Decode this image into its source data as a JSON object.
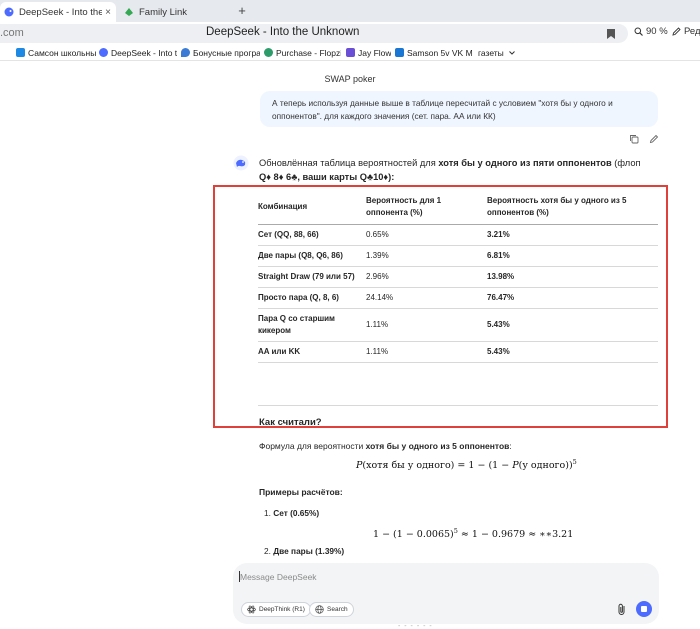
{
  "browser": {
    "tabs": [
      {
        "title": "DeepSeek - Into the Unknown",
        "active": true
      },
      {
        "title": "Family Link",
        "active": false
      }
    ],
    "new_tab_symbol": "+",
    "close_symbol": "×",
    "omnibox": {
      "domain": ".com",
      "title": "DeepSeek - Into the Unknown"
    },
    "zoom": "90 %",
    "edit_label": "Реда",
    "bookmarks": [
      {
        "label": "Самсон школьны",
        "color": "#1e88e5"
      },
      {
        "label": "DeepSeek - Into th",
        "color": "#4d6bfe"
      },
      {
        "label": "Бонусные програ",
        "color": "#3a7bd5"
      },
      {
        "label": "Purchase - Flopzil",
        "color": "#2e9c6a"
      },
      {
        "label": "Jay Flow",
        "color": "#6a4fd6"
      },
      {
        "label": "Samson 5v VK Me",
        "color": "#1976d2"
      },
      {
        "label": "газеты",
        "color": ""
      }
    ]
  },
  "chat": {
    "title": "SWAP poker",
    "user_message": {
      "line1": "А теперь используя данные выше в таблице пересчитай с условием \"хотя бы у одного и",
      "line2": "оппонентов\". для каждого значения (сет. пара. АА или КК)"
    },
    "answer_intro": {
      "prefix": "Обновлённая таблица вероятностей для ",
      "bold": "хотя бы у одного из пяти оппонентов",
      "suffix": " (флоп",
      "line2": "Q♦ 8♦ 6♣, ваши карты Q♣10♦):"
    },
    "table": {
      "headers": [
        "Комбинация",
        "Вероятность для 1 оппонента (%)",
        "Вероятность хотя бы у одного из 5 оппонентов (%)"
      ],
      "rows": [
        [
          "Сет (QQ, 88, 66)",
          "0.65%",
          "3.21%"
        ],
        [
          "Две пары (Q8, Q6, 86)",
          "1.39%",
          "6.81%"
        ],
        [
          "Straight Draw (79 или 57)",
          "2.96%",
          "13.98%"
        ],
        [
          "Просто пара (Q, 8, 6)",
          "24.14%",
          "76.47%"
        ],
        [
          "Пара Q со старшим кикером",
          "1.11%",
          "5.43%"
        ],
        [
          "AA или KK",
          "1.11%",
          "5.43%"
        ]
      ]
    },
    "how_heading": "Как считали?",
    "formula_intro": {
      "prefix": "Формула для вероятности ",
      "bold": "хотя бы у одного из 5 оппонентов",
      "suffix": ":"
    },
    "formula": {
      "lhs": "P",
      "lhs_arg": "(хотя бы у одного)",
      "mid": " = 1 − (1 − ",
      "rhs": "P",
      "rhs_arg": "(у одного))",
      "exp": "5"
    },
    "examples_heading": "Примеры расчётов:",
    "examples": [
      {
        "num": "1.",
        "label": "Сет (0.65%)"
      },
      {
        "num": "2.",
        "label": "Две пары (1.39%)"
      }
    ],
    "example_formula": {
      "left": "1 − (1 − 0.0065)",
      "exp": "5",
      "right": " ≈ 1 − 0.9679 ≈ ∗∗3.21"
    }
  },
  "composer": {
    "placeholder": "Message DeepSeek",
    "deepthink_label": "DeepThink (R1)",
    "search_label": "Search"
  },
  "footer_fragment": "- - - - - -"
}
